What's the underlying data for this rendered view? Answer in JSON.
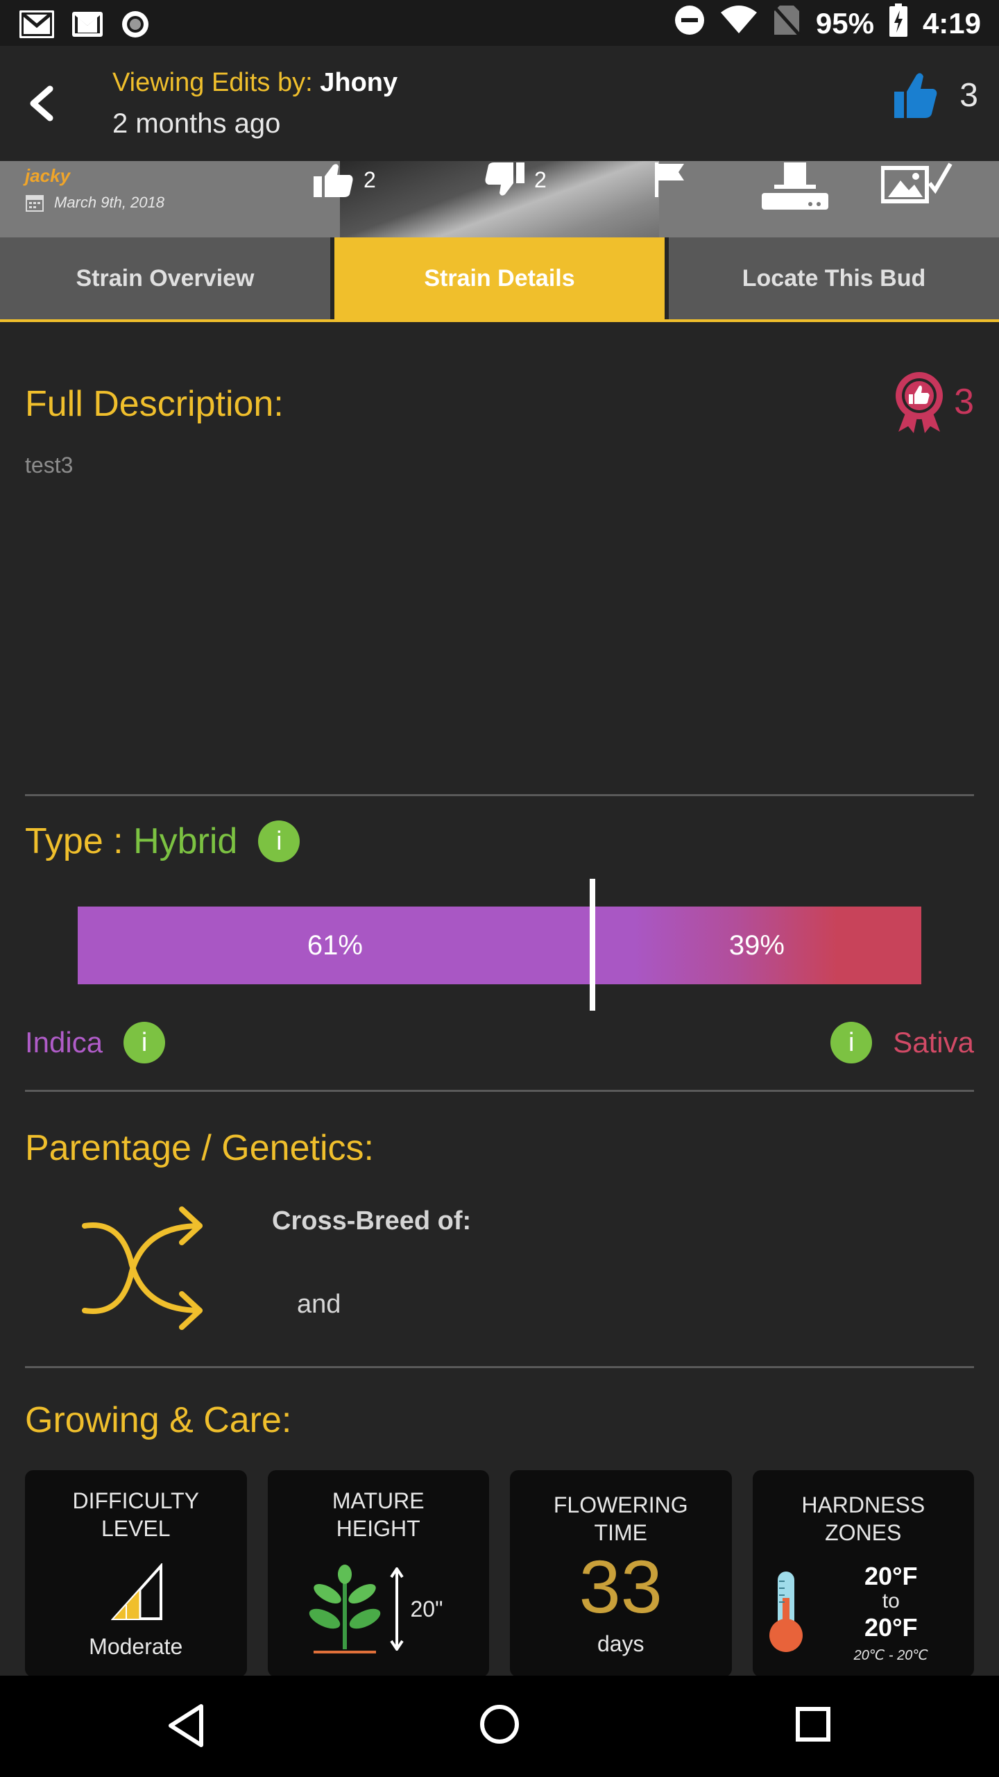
{
  "status_bar": {
    "battery": "95%",
    "time": "4:19",
    "icons": [
      "gmail-icon",
      "mail-icon",
      "record-icon",
      "do-not-disturb-icon",
      "wifi-icon",
      "no-sim-icon",
      "battery-charging-icon"
    ]
  },
  "header": {
    "viewing_label": "Viewing Edits by:",
    "editor": "Jhony",
    "time_ago": "2 months ago",
    "like_count": "3"
  },
  "strip": {
    "user": "jacky",
    "date": "March 9th, 2018",
    "likes": "2",
    "dislikes": "2"
  },
  "tabs": [
    {
      "label": "Strain Overview",
      "active": false
    },
    {
      "label": "Strain Details",
      "active": true
    },
    {
      "label": "Locate This Bud",
      "active": false
    }
  ],
  "description": {
    "title": "Full Description:",
    "text": "test3",
    "award_count": "3"
  },
  "type": {
    "label": "Type :",
    "value": "Hybrid",
    "info": "i",
    "indica_pct": "61%",
    "sativa_pct": "39%",
    "indica_fraction": 0.61,
    "indica_label": "Indica",
    "sativa_label": "Sativa"
  },
  "parentage": {
    "title": "Parentage / Genetics:",
    "cross_label": "Cross-Breed of:",
    "and_label": "and"
  },
  "growing": {
    "title": "Growing & Care:",
    "difficulty": {
      "title_1": "DIFFICULTY",
      "title_2": "LEVEL",
      "value": "Moderate"
    },
    "height": {
      "title_1": "MATURE",
      "title_2": "HEIGHT",
      "value": "20\""
    },
    "flowering": {
      "title_1": "FLOWERING",
      "title_2": "TIME",
      "value": "33",
      "unit": "days"
    },
    "hardness": {
      "title_1": "HARDNESS",
      "title_2": "ZONES",
      "high": "20°F",
      "to": "to",
      "low": "20°F",
      "celsius": "20℃  -  20℃"
    }
  },
  "colors": {
    "accent": "#f0bf2c",
    "hybrid_green": "#7cc242",
    "indica_purple": "#a957c4",
    "sativa_red": "#c8435a",
    "like_blue": "#1a7fd0",
    "award_red": "#c8365c"
  }
}
